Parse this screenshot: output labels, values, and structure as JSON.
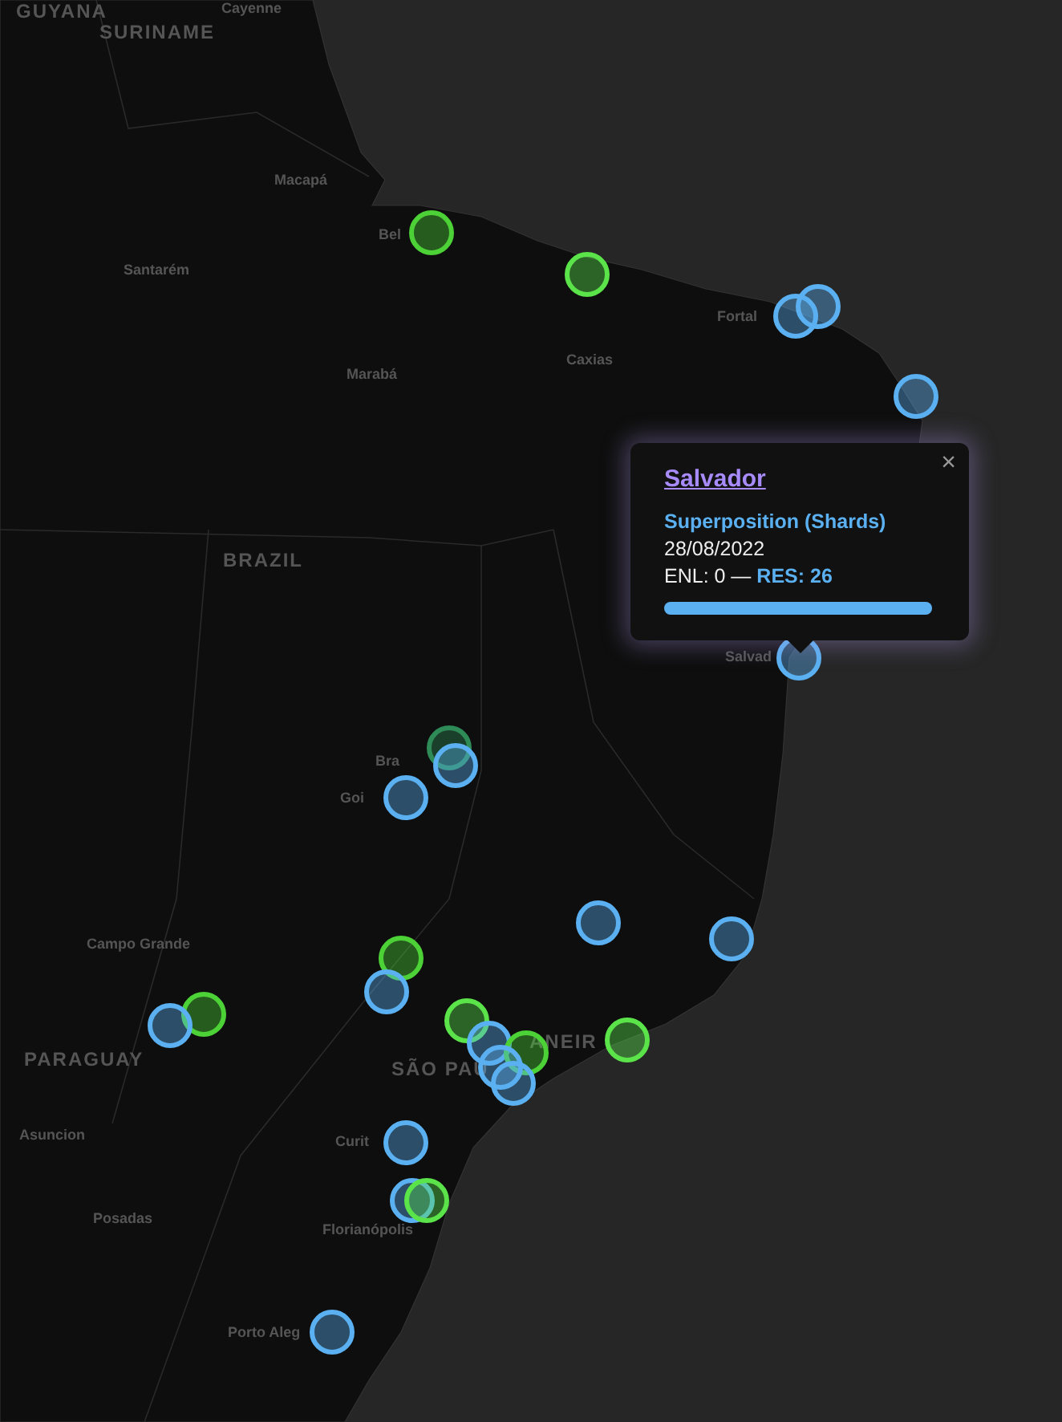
{
  "map": {
    "labels": [
      {
        "text": "GUYANA",
        "kind": "country"
      },
      {
        "text": "SURINAME",
        "kind": "country"
      },
      {
        "text": "Cayenne",
        "kind": "city"
      },
      {
        "text": "Macapá",
        "kind": "city"
      },
      {
        "text": "Bel",
        "kind": "city"
      },
      {
        "text": "Santarém",
        "kind": "city"
      },
      {
        "text": "Marabá",
        "kind": "city"
      },
      {
        "text": "Caxias",
        "kind": "city"
      },
      {
        "text": "Fortal",
        "kind": "city"
      },
      {
        "text": "BRAZIL",
        "kind": "country"
      },
      {
        "text": "Salvad",
        "kind": "city"
      },
      {
        "text": "Bra",
        "kind": "city"
      },
      {
        "text": "Goi",
        "kind": "city"
      },
      {
        "text": "Campo Grande",
        "kind": "city"
      },
      {
        "text": "PARAGUAY",
        "kind": "country"
      },
      {
        "text": "SÃO PAU",
        "kind": "country"
      },
      {
        "text": "ANEIR",
        "kind": "country"
      },
      {
        "text": "Asuncion",
        "kind": "city"
      },
      {
        "text": "Curit",
        "kind": "city"
      },
      {
        "text": "Posadas",
        "kind": "city"
      },
      {
        "text": "Florianópolis",
        "kind": "city"
      },
      {
        "text": "Porto Aleg",
        "kind": "city"
      }
    ],
    "markers": [
      {
        "color": "#4cd137"
      },
      {
        "color": "#5be34a"
      },
      {
        "color": "#5ab0f0"
      },
      {
        "color": "#5ab0f0"
      },
      {
        "color": "#5ab0f0"
      },
      {
        "color": "#5ab0f0"
      },
      {
        "color": "#2e8b57"
      },
      {
        "color": "#5ab0f0"
      },
      {
        "color": "#5ab0f0"
      },
      {
        "color": "#5ab0f0"
      },
      {
        "color": "#5ab0f0"
      },
      {
        "color": "#4cd137"
      },
      {
        "color": "#5ab0f0"
      },
      {
        "color": "#4cd137"
      },
      {
        "color": "#5ab0f0"
      },
      {
        "color": "#5be34a"
      },
      {
        "color": "#5ab0f0"
      },
      {
        "color": "#4cd137"
      },
      {
        "color": "#5ab0f0"
      },
      {
        "color": "#5ab0f0"
      },
      {
        "color": "#5be34a"
      },
      {
        "color": "#5ab0f0"
      },
      {
        "color": "#5ab0f0"
      },
      {
        "color": "#5be34a"
      },
      {
        "color": "#5ab0f0"
      }
    ]
  },
  "popup": {
    "title": "Salvador",
    "close": "×",
    "subtitle": "Superposition (Shards)",
    "date": "28/08/2022",
    "enl": "ENL: 0 — ",
    "res": "RES: 26",
    "level": 1
  }
}
